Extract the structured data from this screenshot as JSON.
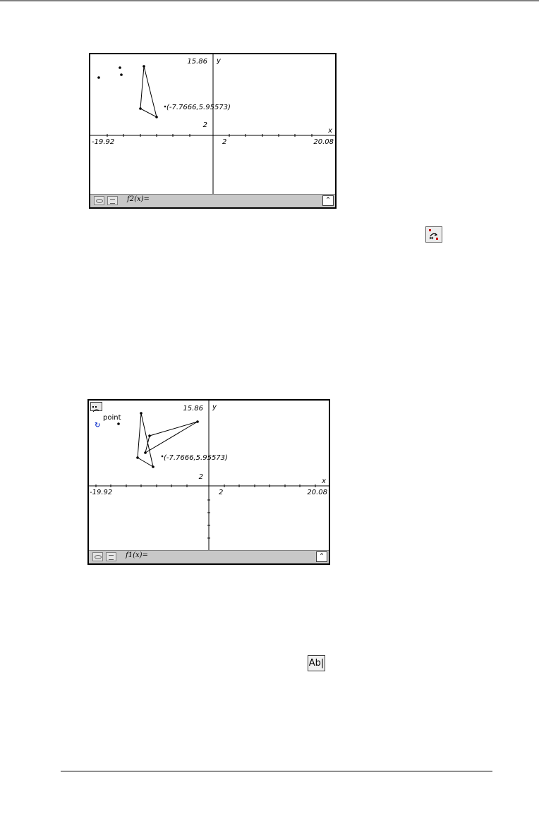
{
  "screen1": {
    "y_max": "15.86",
    "y_axis": "y",
    "x_axis": "x",
    "x_min": "-19.92",
    "x_max": "20.08",
    "x_scale": "2",
    "y_scale": "2",
    "coord_label": "(-7.7666,5.95573)",
    "entry_line": "f2(x)="
  },
  "screen2": {
    "y_max": "15.86",
    "y_axis": "y",
    "x_axis": "x",
    "x_min": "-19.92",
    "x_max": "20.08",
    "x_scale": "2",
    "y_scale": "2",
    "coord_label": "(-7.7666,5.95573)",
    "point_label": "point",
    "entry_line": "f1(x)="
  },
  "icons": {
    "rotate_tool": "rotation-tool-icon",
    "text_tool_label": "Ab|"
  }
}
